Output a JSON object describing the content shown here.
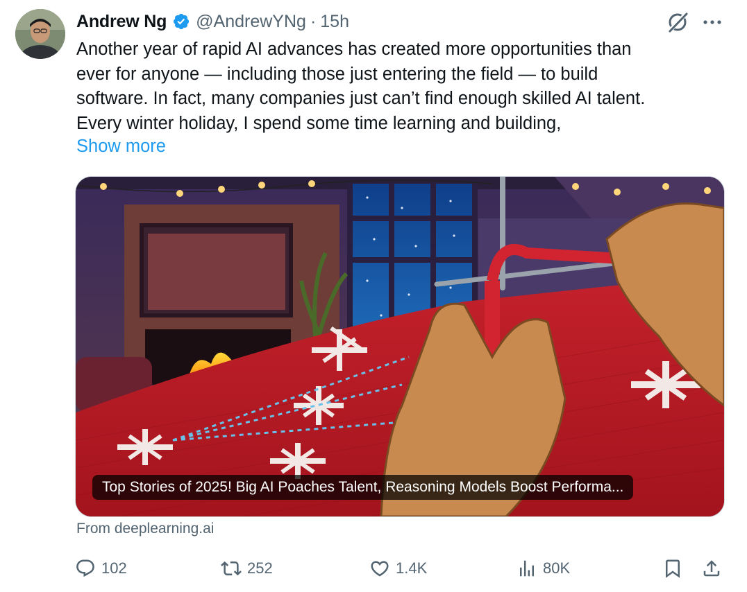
{
  "author": {
    "name": "Andrew Ng",
    "handle": "@AndrewYNg",
    "separator": "·",
    "time": "15h"
  },
  "icons": {
    "verified": "verified-badge-icon",
    "grok": "grok-icon",
    "more": "more-options-icon",
    "reply": "reply-icon",
    "repost": "repost-icon",
    "like": "like-icon",
    "views": "views-icon",
    "bookmark": "bookmark-icon",
    "share": "share-icon"
  },
  "colors": {
    "link": "#1d9bf0",
    "verified": "#1d9bf0",
    "text": "#0f1419",
    "secondary": "#536471"
  },
  "tweet": {
    "lines": [
      "Another year of rapid AI advances has created more opportunities than",
      "ever for anyone — including those just entering the field — to build",
      "software. In fact, many companies just can’t find enough skilled AI talent.",
      "Every winter holiday, I spend some time learning and building,"
    ],
    "show_more": "Show more"
  },
  "card": {
    "caption": "Top Stories of 2025! Big AI Poaches Talent, Reasoning Models Boost Performa...",
    "source": "From deeplearning.ai"
  },
  "stats": {
    "replies": "102",
    "reposts": "252",
    "likes": "1.4K",
    "views": "80K"
  }
}
